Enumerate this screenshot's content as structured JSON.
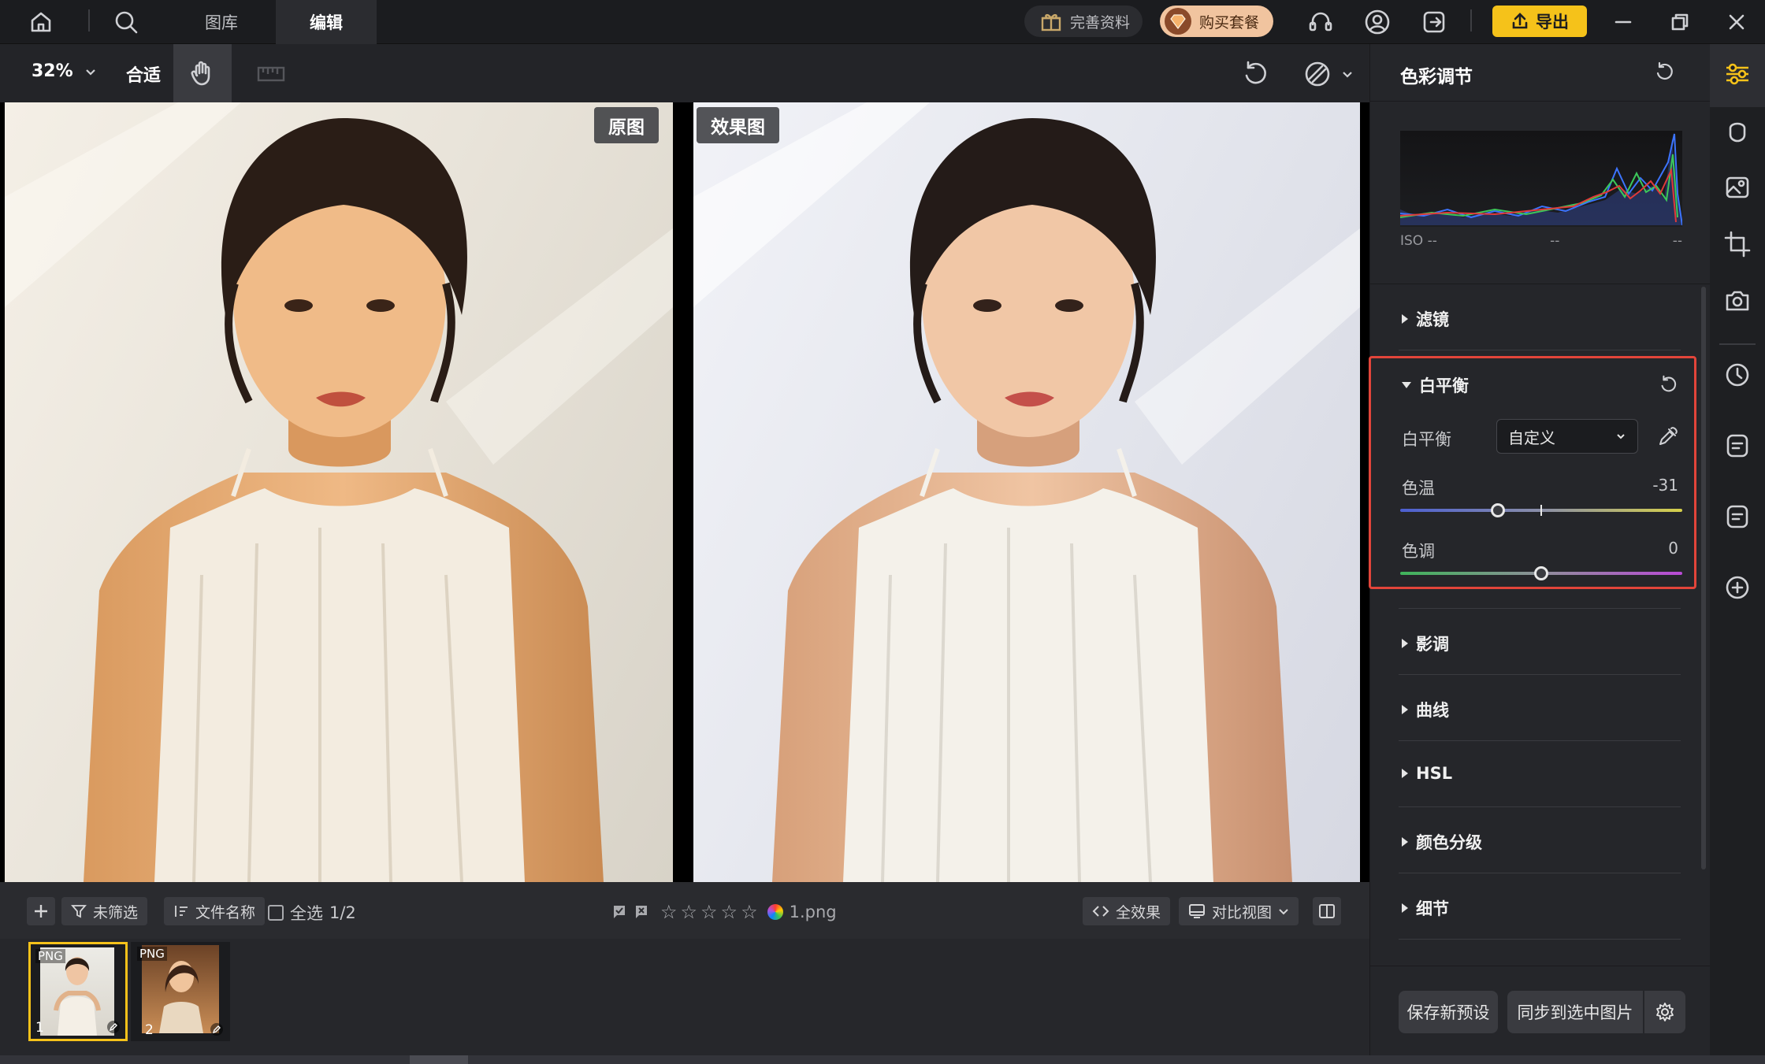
{
  "topbar": {
    "tabs": [
      {
        "label": "图库",
        "active": false
      },
      {
        "label": "编辑",
        "active": true
      }
    ],
    "complete_profile_label": "完善资料",
    "buy_package_label": "购买套餐",
    "export_label": "导出"
  },
  "toolbar": {
    "zoom_value": "32%",
    "fit_label": "合适"
  },
  "canvas": {
    "original_label": "原图",
    "result_label": "效果图"
  },
  "bottombar": {
    "filter_label": "未筛选",
    "sort_label": "文件名称",
    "select_all_label": "全选",
    "selection_count": "1/2",
    "rating_stars": 5,
    "filename": "1.png",
    "all_effects_label": "全效果",
    "compare_view_label": "对比视图"
  },
  "filmstrip": {
    "items": [
      {
        "badge": "PNG",
        "index": "1",
        "selected": true
      },
      {
        "badge": "PNG",
        "index": "2",
        "selected": false
      }
    ]
  },
  "panel": {
    "title": "色彩调节",
    "histogram": {
      "iso": "ISO --",
      "mid": "--",
      "right": "--"
    },
    "sections": {
      "filter": "滤镜",
      "white_balance": "白平衡",
      "tone": "影调",
      "curve": "曲线",
      "hsl": "HSL",
      "color_grading": "颜色分级",
      "detail": "细节"
    },
    "white_balance": {
      "wb_label": "白平衡",
      "wb_mode": "自定义",
      "temp_label": "色温",
      "temp_value": "-31",
      "tint_label": "色调",
      "tint_value": "0"
    },
    "save_preset_label": "保存新预设",
    "sync_label": "同步到选中图片"
  },
  "colors": {
    "accent_yellow": "#f5c21a",
    "highlight_red": "#e2453a",
    "buy_pill": "#f1c49f"
  }
}
